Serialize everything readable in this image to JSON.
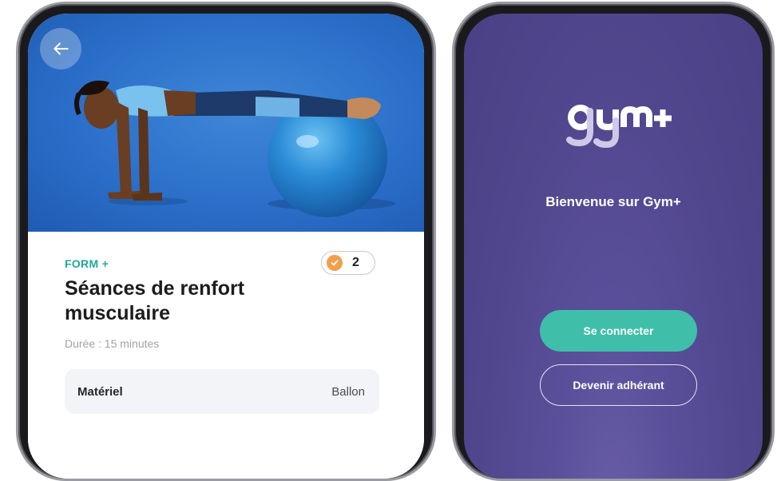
{
  "left_screen": {
    "back_icon": "arrow-left-icon",
    "hero_image": "woman-plank-on-exercise-ball",
    "brand_tag": "FORM +",
    "completed_badge": {
      "icon": "check-circle-icon",
      "count": "2"
    },
    "title": "Séances de renfort musculaire",
    "duration": "Durée : 15 minutes",
    "material": {
      "label": "Matériel",
      "value": "Ballon"
    }
  },
  "right_screen": {
    "logo_alt": "gym+",
    "welcome_text": "Bienvenue sur Gym+",
    "login_button": "Se connecter",
    "join_button": "Devenir adhérant"
  },
  "colors": {
    "accent_teal": "#20a89a",
    "button_teal": "#3fbfa9",
    "badge_orange": "#f0a04b",
    "purple_bg": "#50468d",
    "hero_blue": "#2b6fca"
  }
}
